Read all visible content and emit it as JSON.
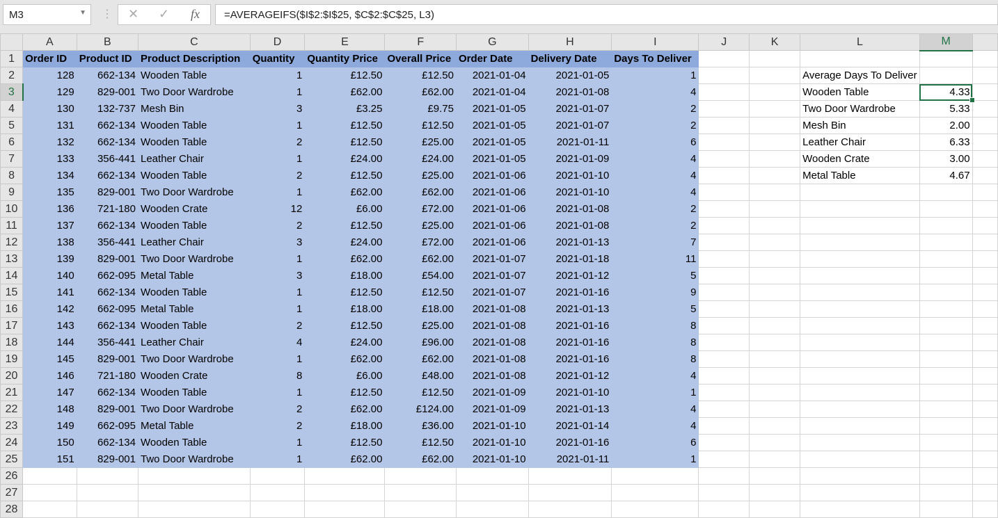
{
  "formula_bar": {
    "name_box": "M3",
    "formula": "=AVERAGEIFS($I$2:$I$25, $C$2:$C$25, L3)",
    "cancel_icon": "✕",
    "enter_icon": "✓",
    "fx_icon": "fx"
  },
  "columns": [
    "A",
    "B",
    "C",
    "D",
    "E",
    "F",
    "G",
    "H",
    "I",
    "J",
    "K",
    "L",
    "M"
  ],
  "selected_column": "M",
  "selected_row": 3,
  "headers": [
    "Order ID",
    "Product ID",
    "Product Description",
    "Quantity",
    "Quantity Price",
    "Overall Price",
    "Order Date",
    "Delivery Date",
    "Days To Deliver"
  ],
  "rows": [
    [
      "128",
      "662-134",
      "Wooden Table",
      "1",
      "£12.50",
      "£12.50",
      "2021-01-04",
      "2021-01-05",
      "1"
    ],
    [
      "129",
      "829-001",
      "Two Door Wardrobe",
      "1",
      "£62.00",
      "£62.00",
      "2021-01-04",
      "2021-01-08",
      "4"
    ],
    [
      "130",
      "132-737",
      "Mesh Bin",
      "3",
      "£3.25",
      "£9.75",
      "2021-01-05",
      "2021-01-07",
      "2"
    ],
    [
      "131",
      "662-134",
      "Wooden Table",
      "1",
      "£12.50",
      "£12.50",
      "2021-01-05",
      "2021-01-07",
      "2"
    ],
    [
      "132",
      "662-134",
      "Wooden Table",
      "2",
      "£12.50",
      "£25.00",
      "2021-01-05",
      "2021-01-11",
      "6"
    ],
    [
      "133",
      "356-441",
      "Leather Chair",
      "1",
      "£24.00",
      "£24.00",
      "2021-01-05",
      "2021-01-09",
      "4"
    ],
    [
      "134",
      "662-134",
      "Wooden Table",
      "2",
      "£12.50",
      "£25.00",
      "2021-01-06",
      "2021-01-10",
      "4"
    ],
    [
      "135",
      "829-001",
      "Two Door Wardrobe",
      "1",
      "£62.00",
      "£62.00",
      "2021-01-06",
      "2021-01-10",
      "4"
    ],
    [
      "136",
      "721-180",
      "Wooden Crate",
      "12",
      "£6.00",
      "£72.00",
      "2021-01-06",
      "2021-01-08",
      "2"
    ],
    [
      "137",
      "662-134",
      "Wooden Table",
      "2",
      "£12.50",
      "£25.00",
      "2021-01-06",
      "2021-01-08",
      "2"
    ],
    [
      "138",
      "356-441",
      "Leather Chair",
      "3",
      "£24.00",
      "£72.00",
      "2021-01-06",
      "2021-01-13",
      "7"
    ],
    [
      "139",
      "829-001",
      "Two Door Wardrobe",
      "1",
      "£62.00",
      "£62.00",
      "2021-01-07",
      "2021-01-18",
      "11"
    ],
    [
      "140",
      "662-095",
      "Metal Table",
      "3",
      "£18.00",
      "£54.00",
      "2021-01-07",
      "2021-01-12",
      "5"
    ],
    [
      "141",
      "662-134",
      "Wooden Table",
      "1",
      "£12.50",
      "£12.50",
      "2021-01-07",
      "2021-01-16",
      "9"
    ],
    [
      "142",
      "662-095",
      "Metal Table",
      "1",
      "£18.00",
      "£18.00",
      "2021-01-08",
      "2021-01-13",
      "5"
    ],
    [
      "143",
      "662-134",
      "Wooden Table",
      "2",
      "£12.50",
      "£25.00",
      "2021-01-08",
      "2021-01-16",
      "8"
    ],
    [
      "144",
      "356-441",
      "Leather Chair",
      "4",
      "£24.00",
      "£96.00",
      "2021-01-08",
      "2021-01-16",
      "8"
    ],
    [
      "145",
      "829-001",
      "Two Door Wardrobe",
      "1",
      "£62.00",
      "£62.00",
      "2021-01-08",
      "2021-01-16",
      "8"
    ],
    [
      "146",
      "721-180",
      "Wooden Crate",
      "8",
      "£6.00",
      "£48.00",
      "2021-01-08",
      "2021-01-12",
      "4"
    ],
    [
      "147",
      "662-134",
      "Wooden Table",
      "1",
      "£12.50",
      "£12.50",
      "2021-01-09",
      "2021-01-10",
      "1"
    ],
    [
      "148",
      "829-001",
      "Two Door Wardrobe",
      "2",
      "£62.00",
      "£124.00",
      "2021-01-09",
      "2021-01-13",
      "4"
    ],
    [
      "149",
      "662-095",
      "Metal Table",
      "2",
      "£18.00",
      "£36.00",
      "2021-01-10",
      "2021-01-14",
      "4"
    ],
    [
      "150",
      "662-134",
      "Wooden Table",
      "1",
      "£12.50",
      "£12.50",
      "2021-01-10",
      "2021-01-16",
      "6"
    ],
    [
      "151",
      "829-001",
      "Two Door Wardrobe",
      "1",
      "£62.00",
      "£62.00",
      "2021-01-10",
      "2021-01-11",
      "1"
    ]
  ],
  "summary": {
    "title": "Average Days To Deliver",
    "items": [
      {
        "label": "Wooden Table",
        "value": "4.33"
      },
      {
        "label": "Two Door Wardrobe",
        "value": "5.33"
      },
      {
        "label": "Mesh Bin",
        "value": "2.00"
      },
      {
        "label": "Leather Chair",
        "value": "6.33"
      },
      {
        "label": "Wooden Crate",
        "value": "3.00"
      },
      {
        "label": "Metal Table",
        "value": "4.67"
      }
    ]
  },
  "row_numbers": [
    "1",
    "2",
    "3",
    "4",
    "5",
    "6",
    "7",
    "8",
    "9",
    "10",
    "11",
    "12",
    "13",
    "14",
    "15",
    "16",
    "17",
    "18",
    "19",
    "20",
    "21",
    "22",
    "23",
    "24",
    "25",
    "26",
    "27",
    "28"
  ]
}
